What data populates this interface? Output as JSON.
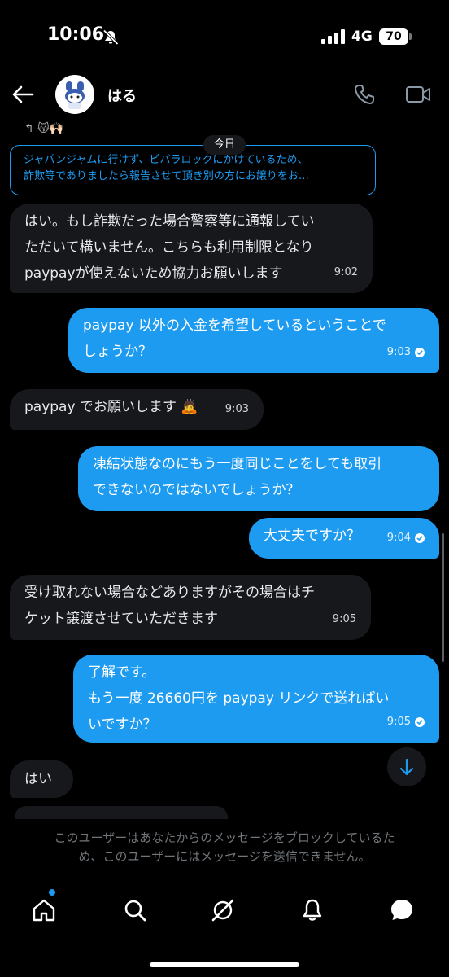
{
  "status": {
    "time": "10:06",
    "network": "4G",
    "battery": "70"
  },
  "header": {
    "contact_name": "はる"
  },
  "reactions": "↰ 😽🙌🏻",
  "date_chip": "今日",
  "quoted": {
    "line1": "ジャパンジャムに行けず、ビバラロックにかけているため、",
    "line2": "詐欺等でありましたら報告させて頂き別の方にお譲りをお…"
  },
  "messages": [
    {
      "dir": "in",
      "lines": [
        "はい。もし詐欺だった場合警察等に通報してい",
        "ただいて構いません。こちらも利用制限となり",
        "paypayが使えないため協力お願いします"
      ],
      "time": "9:02",
      "read": false
    },
    {
      "dir": "out",
      "lines": [
        "paypay 以外の入金を希望しているということで",
        "しょうか？"
      ],
      "time": "9:03",
      "read": true
    },
    {
      "dir": "in",
      "lines": [
        "paypay でお願いします 🙇"
      ],
      "time": "9:03",
      "read": false
    },
    {
      "dir": "out",
      "lines": [
        "凍結状態なのにもう一度同じことをしても取引",
        "できないのではないでしょうか？"
      ],
      "time": "",
      "read": false
    },
    {
      "dir": "out",
      "lines": [
        "大丈夫ですか？"
      ],
      "time": "9:04",
      "read": true
    },
    {
      "dir": "in",
      "lines": [
        "受け取れない場合などありますがその場合はチ",
        "ケット譲渡させていただきます"
      ],
      "time": "9:05",
      "read": false
    },
    {
      "dir": "out",
      "lines": [
        "了解です。",
        "もう一度 26660円を paypay リンクで送ればい",
        "いですか？"
      ],
      "time": "9:05",
      "read": true
    },
    {
      "dir": "in",
      "lines": [
        "はい"
      ],
      "time": "",
      "read": false
    }
  ],
  "blocked_notice": {
    "line1": "このユーザーはあなたからのメッセージをブロックしているた",
    "line2": "め、このユーザーにはメッセージを送信できません。"
  },
  "colors": {
    "accent": "#1d9bf0",
    "bubble_in": "#16181c",
    "background": "#000000"
  },
  "icons": [
    "bell-off-icon",
    "signal-icon",
    "back-arrow-icon",
    "phone-icon",
    "video-icon",
    "chevron-down-icon",
    "home-icon",
    "search-icon",
    "grok-icon",
    "bell-icon",
    "messages-icon"
  ]
}
